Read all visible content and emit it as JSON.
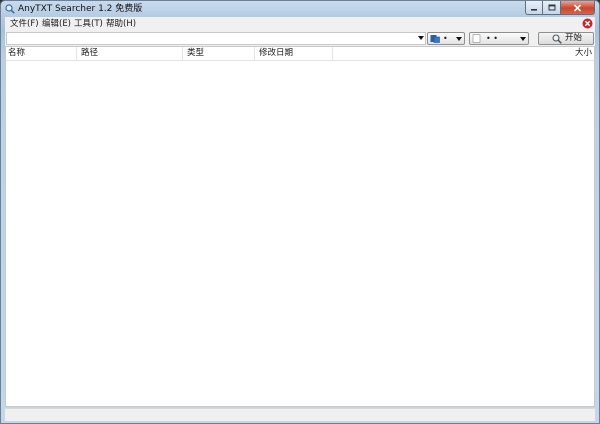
{
  "window": {
    "title": "AnyTXT Searcher 1.2 免费版"
  },
  "menubar": {
    "items": [
      {
        "label": "文件(F)"
      },
      {
        "label": "编辑(E)"
      },
      {
        "label": "工具(T)"
      },
      {
        "label": "帮助(H)"
      }
    ]
  },
  "toolbar": {
    "query_value": "",
    "type_combo_value": "•",
    "date_combo_value": "• •",
    "search_label": "开始"
  },
  "list": {
    "columns": [
      {
        "label": "名称"
      },
      {
        "label": "路径"
      },
      {
        "label": "类型"
      },
      {
        "label": "修改日期"
      },
      {
        "label": "大小"
      }
    ],
    "rows": []
  },
  "statusbar": {
    "text": ""
  },
  "colors": {
    "titlebar": "#b7cce2",
    "close_button": "#c8472e",
    "menubar": "#f0f0f0",
    "list_background": "#ffffff"
  },
  "icons": [
    "app-icon",
    "minimize-icon",
    "maximize-icon",
    "close-icon",
    "menu-close-icon",
    "dropdown-arrow-icon",
    "file-type-icon",
    "date-icon",
    "search-icon"
  ]
}
